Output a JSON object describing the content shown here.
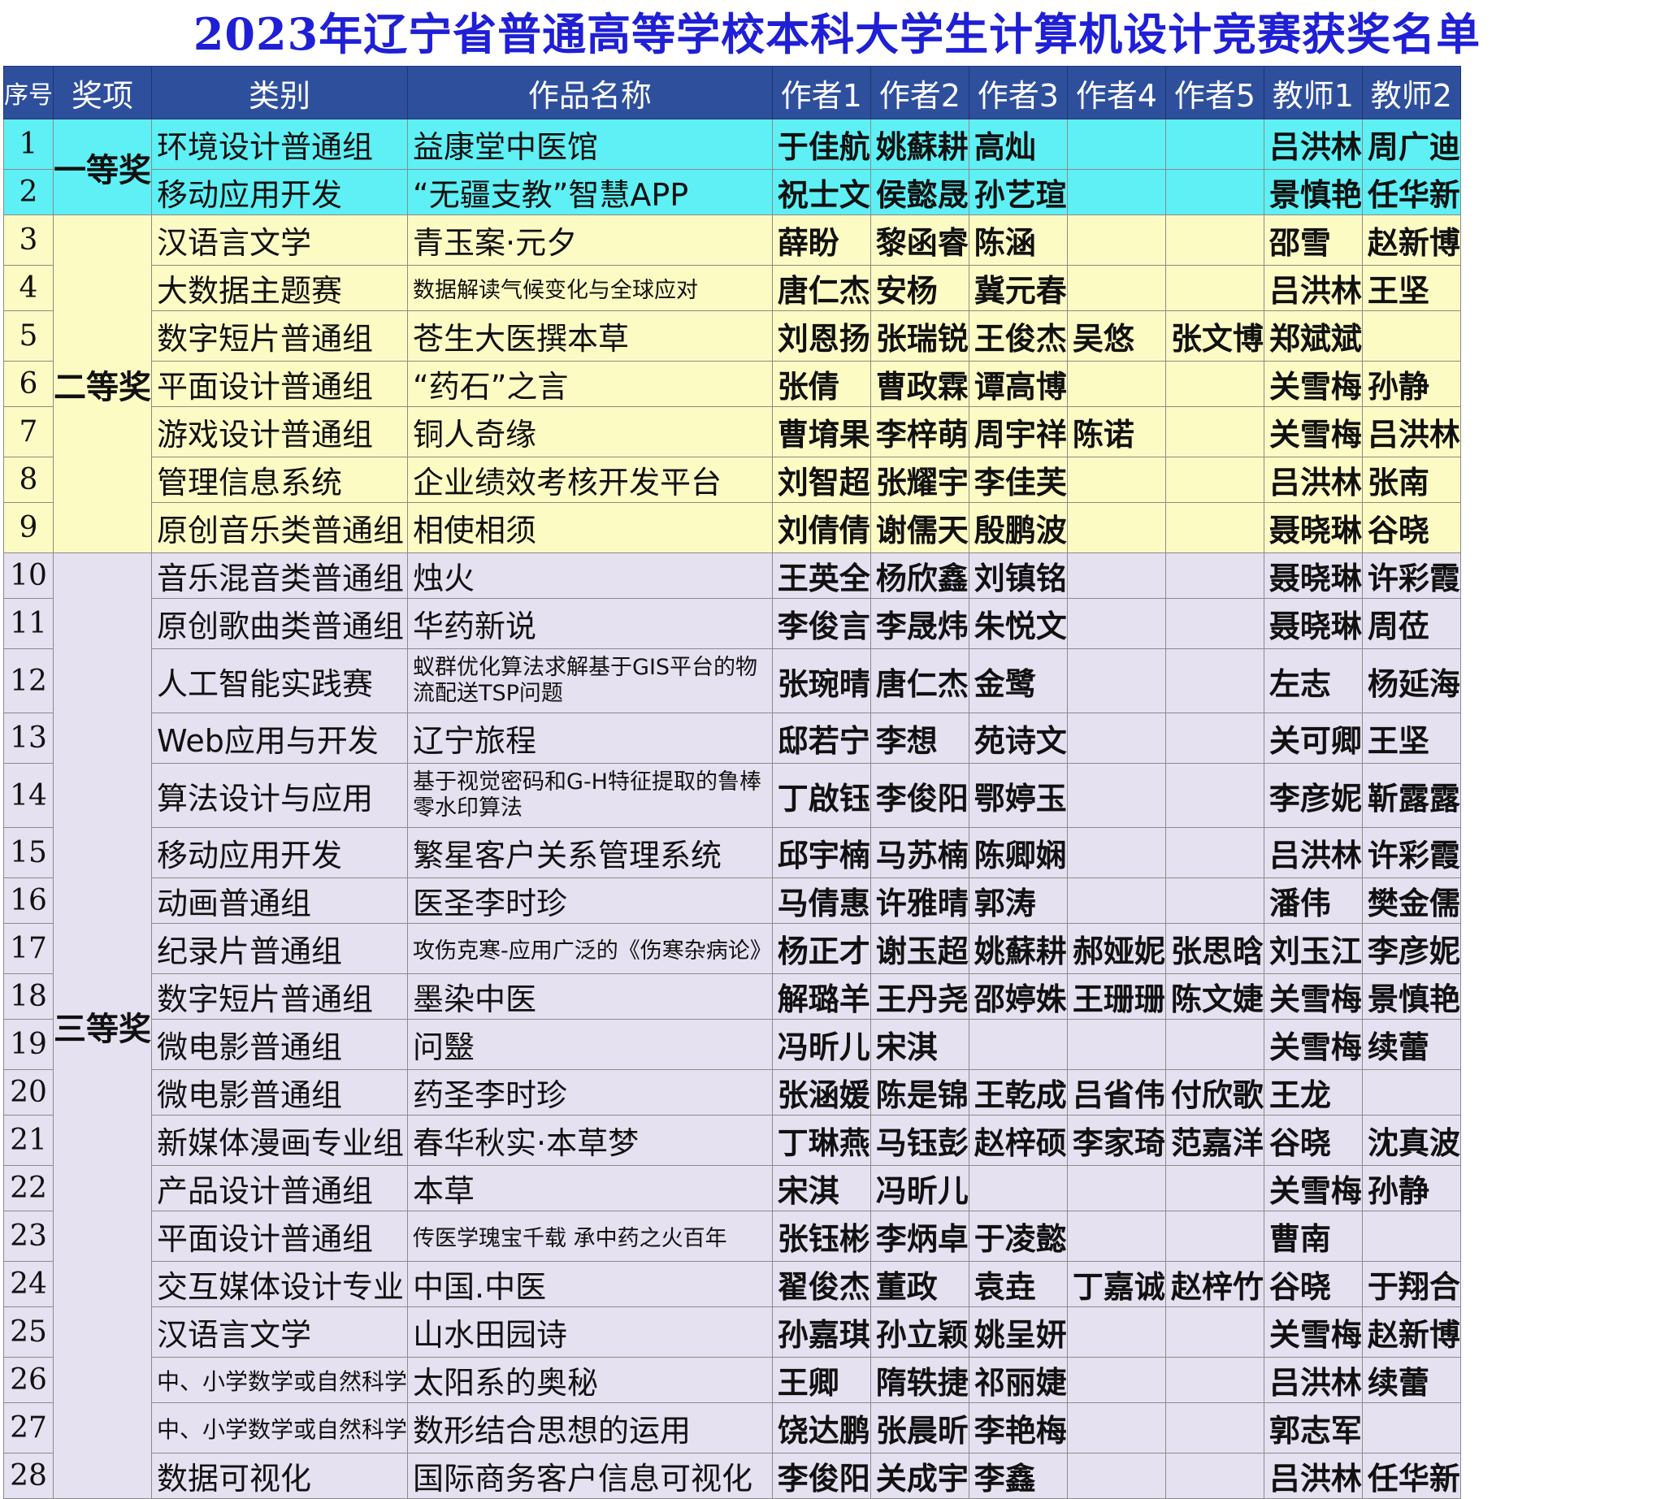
{
  "title": "2023年辽宁省普通高等学校本科大学生计算机设计竞赛获奖名单",
  "colors": {
    "title": "#1f1fd6",
    "header_bg": "#2e4f9c",
    "first_prize": "#5ef0f4",
    "second_prize": "#fdfbc4",
    "third_prize": "#e6e1f0"
  },
  "headers": [
    "序号",
    "奖项",
    "类别",
    "作品名称",
    "作者1",
    "作者2",
    "作者3",
    "作者4",
    "作者5",
    "教师1",
    "教师2"
  ],
  "awards": {
    "first": "一等奖",
    "second": "二等奖",
    "third": "三等奖"
  },
  "rows": [
    {
      "no": "1",
      "category": "环境设计普通组",
      "work": "益康堂中医馆",
      "a1": "于佳航",
      "a2": "姚蘇耕",
      "a3": "高灿",
      "a4": "",
      "a5": "",
      "t1": "吕洪林",
      "t2": "周广迪"
    },
    {
      "no": "2",
      "category": "移动应用开发",
      "work": "“无疆支教”智慧APP",
      "a1": "祝士文",
      "a2": "侯懿晟",
      "a3": "孙艺瑄",
      "a4": "",
      "a5": "",
      "t1": "景慎艳",
      "t2": "任华新"
    },
    {
      "no": "3",
      "category": "汉语言文学",
      "work": "青玉案·元夕",
      "a1": "薛盼",
      "a2": "黎函睿",
      "a3": "陈涵",
      "a4": "",
      "a5": "",
      "t1": "邵雪",
      "t2": "赵新博"
    },
    {
      "no": "4",
      "category": "大数据主题赛",
      "work": "数据解读气候变化与全球应对",
      "a1": "唐仁杰",
      "a2": "安杨",
      "a3": "冀元春",
      "a4": "",
      "a5": "",
      "t1": "吕洪林",
      "t2": "王坚"
    },
    {
      "no": "5",
      "category": "数字短片普通组",
      "work": "苍生大医撰本草",
      "a1": "刘恩扬",
      "a2": "张瑞锐",
      "a3": "王俊杰",
      "a4": "吴悠",
      "a5": "张文博",
      "t1": "郑斌斌",
      "t2": ""
    },
    {
      "no": "6",
      "category": "平面设计普通组",
      "work": "“药石”之言",
      "a1": "张倩",
      "a2": "曹政霖",
      "a3": "谭高博",
      "a4": "",
      "a5": "",
      "t1": "关雪梅",
      "t2": "孙静"
    },
    {
      "no": "7",
      "category": "游戏设计普通组",
      "work": "铜人奇缘",
      "a1": "曹堉果",
      "a2": "李梓萌",
      "a3": "周宇祥",
      "a4": "陈诺",
      "a5": "",
      "t1": "关雪梅",
      "t2": "吕洪林"
    },
    {
      "no": "8",
      "category": "管理信息系统",
      "work": "企业绩效考核开发平台",
      "a1": "刘智超",
      "a2": "张耀宇",
      "a3": "李佳芙",
      "a4": "",
      "a5": "",
      "t1": "吕洪林",
      "t2": "张南"
    },
    {
      "no": "9",
      "category": "原创音乐类普通组",
      "work": "相使相须",
      "a1": "刘倩倩",
      "a2": "谢儒天",
      "a3": "殷鹏波",
      "a4": "",
      "a5": "",
      "t1": "聂晓琳",
      "t2": "谷晓"
    },
    {
      "no": "10",
      "category": "音乐混音类普通组",
      "work": "烛火",
      "a1": "王英全",
      "a2": "杨欣鑫",
      "a3": "刘镇铭",
      "a4": "",
      "a5": "",
      "t1": "聂晓琳",
      "t2": "许彩霞"
    },
    {
      "no": "11",
      "category": "原创歌曲类普通组",
      "work": "华药新说",
      "a1": "李俊言",
      "a2": "李晟炜",
      "a3": "朱悦文",
      "a4": "",
      "a5": "",
      "t1": "聂晓琳",
      "t2": "周莅"
    },
    {
      "no": "12",
      "category": "人工智能实践赛",
      "work": "蚁群优化算法求解基于GIS平台的物流配送TSP问题",
      "a1": "张琬晴",
      "a2": "唐仁杰",
      "a3": "金鹭",
      "a4": "",
      "a5": "",
      "t1": "左志",
      "t2": "杨延海"
    },
    {
      "no": "13",
      "category": "Web应用与开发",
      "work": "辽宁旅程",
      "a1": "邸若宁",
      "a2": "李想",
      "a3": "苑诗文",
      "a4": "",
      "a5": "",
      "t1": "关可卿",
      "t2": "王坚"
    },
    {
      "no": "14",
      "category": "算法设计与应用",
      "work": "基于视觉密码和G-H特征提取的鲁棒零水印算法",
      "a1": "丁啟钰",
      "a2": "李俊阳",
      "a3": "鄂婷玉",
      "a4": "",
      "a5": "",
      "t1": "李彦妮",
      "t2": "靳露露"
    },
    {
      "no": "15",
      "category": "移动应用开发",
      "work": "繁星客户关系管理系统",
      "a1": "邱宇楠",
      "a2": "马苏楠",
      "a3": "陈卿娴",
      "a4": "",
      "a5": "",
      "t1": "吕洪林",
      "t2": "许彩霞"
    },
    {
      "no": "16",
      "category": "动画普通组",
      "work": "医圣李时珍",
      "a1": "马倩惠",
      "a2": "许雅晴",
      "a3": "郭涛",
      "a4": "",
      "a5": "",
      "t1": "潘伟",
      "t2": "樊金儒"
    },
    {
      "no": "17",
      "category": "纪录片普通组",
      "work": "攻伤克寒-应用广泛的《伤寒杂病论》",
      "a1": "杨正才",
      "a2": "谢玉超",
      "a3": "姚蘇耕",
      "a4": "郝娅妮",
      "a5": "张思晗",
      "t1": "刘玉江",
      "t2": "李彦妮"
    },
    {
      "no": "18",
      "category": "数字短片普通组",
      "work": "墨染中医",
      "a1": "解璐羊",
      "a2": "王丹尧",
      "a3": "邵婷姝",
      "a4": "王珊珊",
      "a5": "陈文婕",
      "t1": "关雪梅",
      "t2": "景慎艳"
    },
    {
      "no": "19",
      "category": "微电影普通组",
      "work": "问毉",
      "a1": "冯昕儿",
      "a2": "宋淇",
      "a3": "",
      "a4": "",
      "a5": "",
      "t1": "关雪梅",
      "t2": "续蕾"
    },
    {
      "no": "20",
      "category": "微电影普通组",
      "work": "药圣李时珍",
      "a1": "张涵媛",
      "a2": "陈是锦",
      "a3": "王乾成",
      "a4": "吕省伟",
      "a5": "付欣歌",
      "t1": "王龙",
      "t2": ""
    },
    {
      "no": "21",
      "category": "新媒体漫画专业组",
      "work": "春华秋实·本草梦",
      "a1": "丁琳燕",
      "a2": "马钰彭",
      "a3": "赵梓硕",
      "a4": "李家琦",
      "a5": "范嘉洋",
      "t1": "谷晓",
      "t2": "沈真波"
    },
    {
      "no": "22",
      "category": "产品设计普通组",
      "work": "本草",
      "a1": "宋淇",
      "a2": "冯昕儿",
      "a3": "",
      "a4": "",
      "a5": "",
      "t1": "关雪梅",
      "t2": "孙静"
    },
    {
      "no": "23",
      "category": "平面设计普通组",
      "work": "传医学瑰宝千载 承中药之火百年",
      "a1": "张钰彬",
      "a2": "李炳卓",
      "a3": "于凌懿",
      "a4": "",
      "a5": "",
      "t1": "曹南",
      "t2": ""
    },
    {
      "no": "24",
      "category": "交互媒体设计专业",
      "work": "中国.中医",
      "a1": "翟俊杰",
      "a2": "董政",
      "a3": "袁垚",
      "a4": "丁嘉诚",
      "a5": "赵梓竹",
      "t1": "谷晓",
      "t2": "于翔合"
    },
    {
      "no": "25",
      "category": "汉语言文学",
      "work": "山水田园诗",
      "a1": "孙嘉琪",
      "a2": "孙立颖",
      "a3": "姚呈妍",
      "a4": "",
      "a5": "",
      "t1": "关雪梅",
      "t2": "赵新博"
    },
    {
      "no": "26",
      "category": "中、小学数学或自然科学",
      "work": "太阳系的奥秘",
      "a1": "王卿",
      "a2": "隋轶捷",
      "a3": "祁丽婕",
      "a4": "",
      "a5": "",
      "t1": "吕洪林",
      "t2": "续蕾"
    },
    {
      "no": "27",
      "category": "中、小学数学或自然科学",
      "work": "数形结合思想的运用",
      "a1": "饶达鹏",
      "a2": "张晨昕",
      "a3": "李艳梅",
      "a4": "",
      "a5": "",
      "t1": "郭志军",
      "t2": ""
    },
    {
      "no": "28",
      "category": "数据可视化",
      "work": "国际商务客户信息可视化",
      "a1": "李俊阳",
      "a2": "关成宇",
      "a3": "李鑫",
      "a4": "",
      "a5": "",
      "t1": "吕洪林",
      "t2": "任华新"
    }
  ]
}
